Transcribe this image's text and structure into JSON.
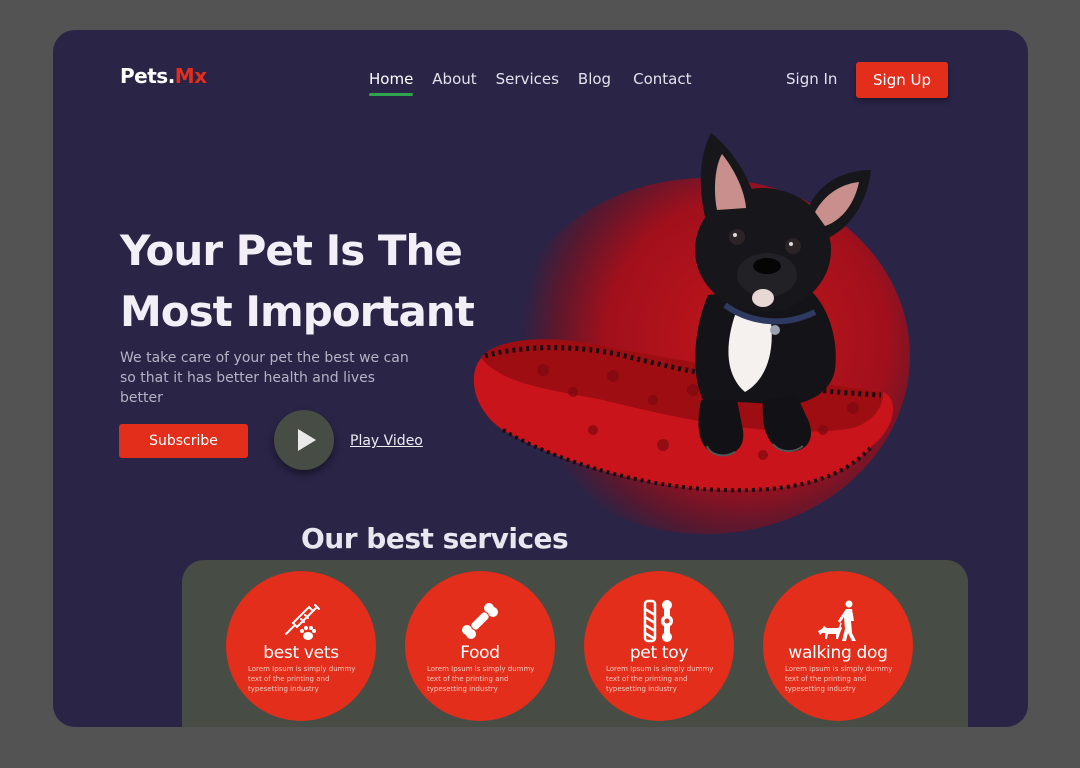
{
  "header": {
    "logo_main": "Pets.",
    "logo_accent": "Mx",
    "nav": [
      "Home",
      "About",
      "Services",
      "Blog",
      "Contact"
    ],
    "active_nav": "Home",
    "signin_label": "Sign In",
    "signup_label": "Sign Up"
  },
  "hero": {
    "title": "Your Pet Is The Most Important",
    "subtitle": "We take care of your pet the best we can so that it has better health and lives better",
    "subscribe_label": "Subscribe",
    "play_label": "Play Video"
  },
  "services": {
    "heading": "Our best services",
    "items": [
      {
        "title": "best vets",
        "icon": "syringe-paw-icon",
        "desc": "Lorem Ipsum is simply dummy text of the printing and typesetting industry"
      },
      {
        "title": "Food",
        "icon": "bone-icon",
        "desc": "Lorem Ipsum is simply dummy text of the printing and typesetting industry"
      },
      {
        "title": "pet toy",
        "icon": "chew-toy-icon",
        "desc": "Lorem Ipsum is simply dummy text of the printing and typesetting industry"
      },
      {
        "title": "walking dog",
        "icon": "dog-walker-icon",
        "desc": "Lorem Ipsum is simply dummy text of the printing and typesetting industry"
      }
    ]
  },
  "colors": {
    "background": "#535353",
    "frame": "#2a2447",
    "accent": "#e22e1b",
    "services_panel": "#474c44",
    "active_underline": "#2ea44f"
  }
}
